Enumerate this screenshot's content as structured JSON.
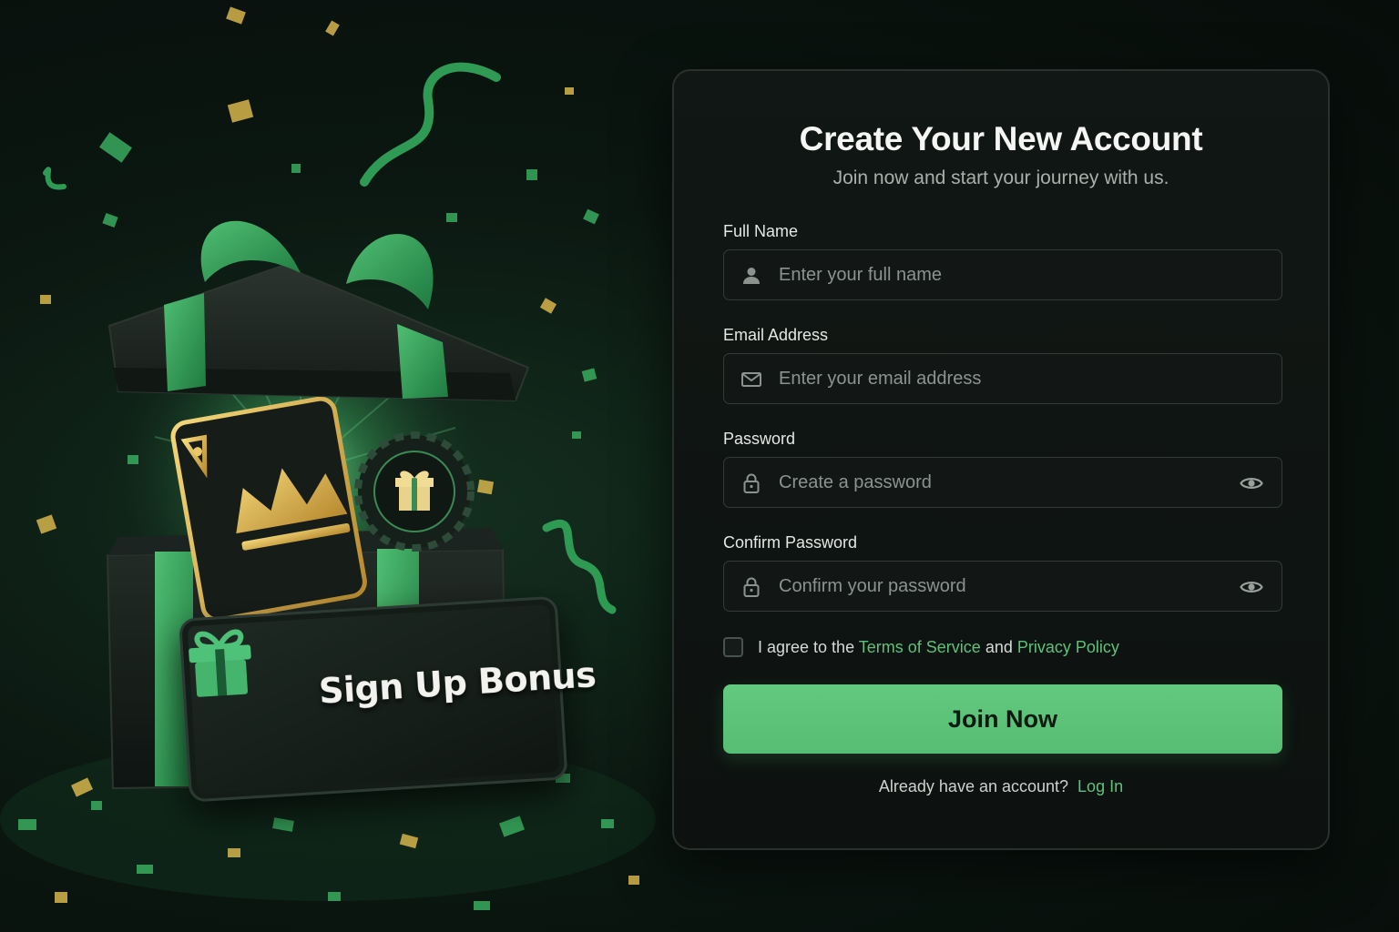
{
  "promo": {
    "badge_text": "Sign Up Bonus"
  },
  "form": {
    "title": "Create Your New Account",
    "subtitle": "Join now and start your journey with us.",
    "full_name": {
      "label": "Full Name",
      "placeholder": "Enter your full name",
      "icon": "user-icon"
    },
    "email": {
      "label": "Email Address",
      "placeholder": "Enter your email address",
      "icon": "mail-icon"
    },
    "password": {
      "label": "Password",
      "placeholder": "Create a password",
      "icon": "lock-icon",
      "toggle_icon": "eye-icon"
    },
    "confirm_password": {
      "label": "Confirm Password",
      "placeholder": "Confirm your password",
      "icon": "lock-icon",
      "toggle_icon": "eye-icon"
    },
    "agree": {
      "prefix": "I agree to the",
      "terms": "Terms of Service",
      "conjunction": "and",
      "privacy": "Privacy Policy",
      "checked": false
    },
    "submit_label": "Join Now",
    "login_prompt": "Already have an account?",
    "login_link": "Log In"
  },
  "colors": {
    "accent": "#5cc27a",
    "button": "#5cbf76",
    "background": "#0b1711",
    "card": "#111714",
    "gold": "#d9b24a"
  }
}
